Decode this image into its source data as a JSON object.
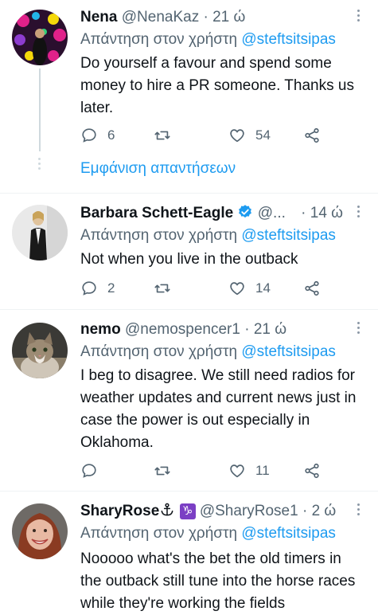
{
  "replies": [
    {
      "name": "Nena",
      "handle": "@NenaKaz",
      "sep": "·",
      "time": "21 ώ",
      "replying_prefix": "Απάντηση στον χρήστη",
      "replying_to": "@steftsitsipas",
      "text": "Do yourself a favour and spend some money to hire a PR someone. Thanks us later.",
      "replies": "6",
      "retweets": "",
      "likes": "54",
      "show_replies": "Εμφάνιση απαντήσεων"
    },
    {
      "name": "Barbara Schett-Eagle",
      "handle": "@...",
      "sep": "·",
      "time": "14 ώ",
      "replying_prefix": "Απάντηση στον χρήστη",
      "replying_to": "@steftsitsipas",
      "text": "Not when you live in the outback",
      "replies": "2",
      "retweets": "",
      "likes": "14"
    },
    {
      "name": "nemo",
      "handle": "@nemospencer1",
      "sep": "·",
      "time": "21 ώ",
      "replying_prefix": "Απάντηση στον χρήστη",
      "replying_to": "@steftsitsipas",
      "text": "I beg to disagree. We still need radios for weather updates and current news just in case the power is out especially in Oklahoma.",
      "replies": "",
      "retweets": "",
      "likes": "11"
    },
    {
      "name": "SharyRose",
      "emoji": "♑",
      "handle": "@SharyRose1",
      "sep": "·",
      "time": "2 ώ",
      "replying_prefix": "Απάντηση στον χρήστη",
      "replying_to": "@steftsitsipas",
      "text": "Nooooo what's the bet the old timers in the outback still tune into the horse races while they're working the fields"
    }
  ],
  "colors": {
    "link": "#1d9bf0",
    "muted": "#536471",
    "text": "#0f1419"
  }
}
